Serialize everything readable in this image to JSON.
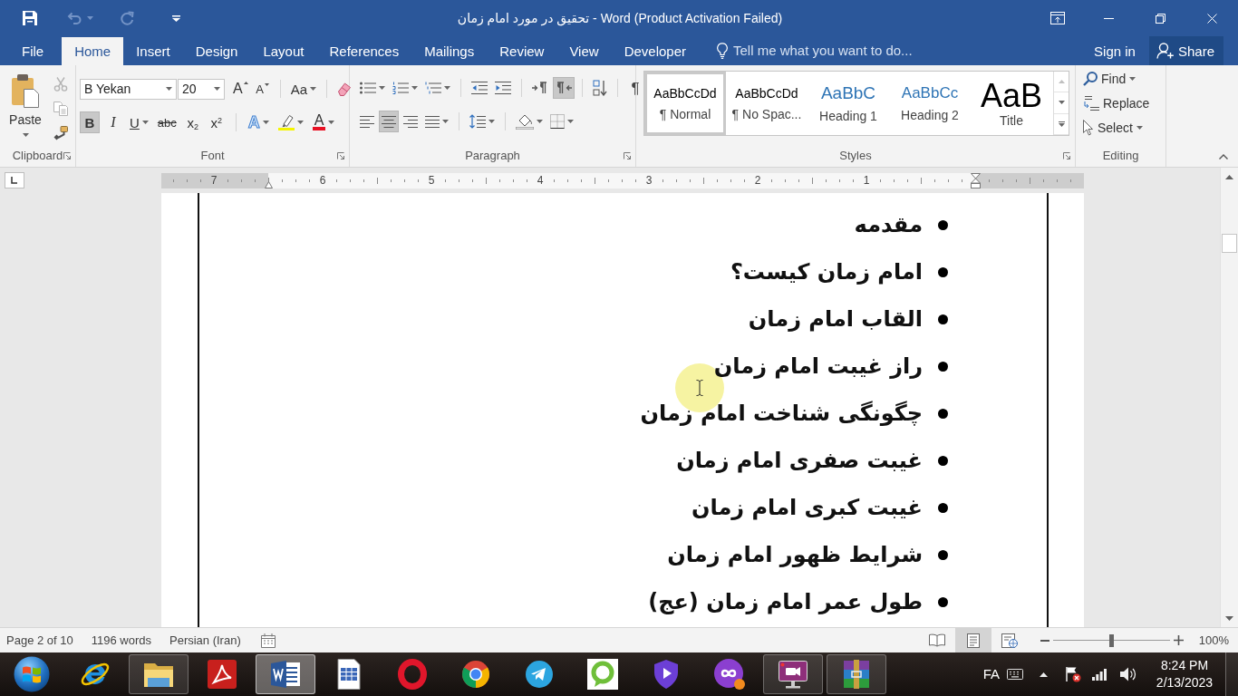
{
  "window": {
    "title": "تحقیق در مورد امام زمان - Word (Product Activation Failed)"
  },
  "quick_access": [
    {
      "disabled": false
    },
    {
      "disabled": true
    },
    {
      "disabled": true
    },
    {
      "disabled": false
    }
  ],
  "tabs": [
    {
      "label": "File",
      "selected": false
    },
    {
      "label": "Home",
      "selected": true
    },
    {
      "label": "Insert",
      "selected": false
    },
    {
      "label": "Design",
      "selected": false
    },
    {
      "label": "Layout",
      "selected": false
    },
    {
      "label": "References",
      "selected": false
    },
    {
      "label": "Mailings",
      "selected": false
    },
    {
      "label": "Review",
      "selected": false
    },
    {
      "label": "View",
      "selected": false
    },
    {
      "label": "Developer",
      "selected": false
    }
  ],
  "tell_me": {
    "placeholder": "Tell me what you want to do..."
  },
  "account": {
    "sign_in": "Sign in",
    "share": "Share"
  },
  "ribbon": {
    "clipboard": {
      "label": "Clipboard",
      "paste": "Paste",
      "tools": [
        {
          "disabled": true
        },
        {
          "disabled": true
        },
        {
          "disabled": false
        }
      ]
    },
    "font": {
      "label": "Font",
      "font_name": "B Yekan",
      "font_size": "20",
      "grow": "A",
      "shrink": "A",
      "change_case": "Aa",
      "formats": [
        {
          "kind": "bold",
          "label": "B",
          "selected": true,
          "dropdown": false
        },
        {
          "kind": "italic",
          "label": "I",
          "selected": false,
          "dropdown": false
        },
        {
          "kind": "underline",
          "label": "U",
          "selected": false,
          "dropdown": true
        },
        {
          "kind": "strike",
          "label": "abc",
          "selected": false,
          "dropdown": false
        },
        {
          "kind": "sub",
          "label": "x$_{2}$",
          "selected": false,
          "dropdown": false
        },
        {
          "kind": "sup",
          "label": "x$^{2}$",
          "selected": false,
          "dropdown": false
        }
      ],
      "text_effects": "A",
      "font_color": "A"
    },
    "paragraph": {
      "label": "Paragraph",
      "direction": [
        {
          "selected": false
        },
        {
          "selected": true
        }
      ],
      "show_marks": "¶",
      "alignment": [
        {
          "selected": false
        },
        {
          "selected": true
        },
        {
          "selected": false
        },
        {
          "selected": false
        }
      ]
    },
    "styles": {
      "label": "Styles",
      "items": [
        {
          "kind": "body",
          "preview": "AaBbCcDd",
          "name": "¶ Normal",
          "selected": true
        },
        {
          "kind": "body",
          "preview": "AaBbCcDd",
          "name": "¶ No Spac...",
          "selected": false
        },
        {
          "kind": "heading1",
          "preview": "AaBbC",
          "name": "Heading 1",
          "selected": false
        },
        {
          "kind": "heading2",
          "preview": "AaBbCc",
          "name": "Heading 2",
          "selected": false
        },
        {
          "kind": "title",
          "preview": "AaB",
          "name": "Title",
          "selected": false
        }
      ]
    },
    "editing": {
      "label": "Editing",
      "items": [
        {
          "label": "Find",
          "dropdown": true
        },
        {
          "label": "Replace",
          "dropdown": false
        },
        {
          "label": "Select",
          "dropdown": true
        }
      ]
    }
  },
  "ruler": {
    "numbers": [
      "7",
      "6",
      "5",
      "4",
      "3",
      "2",
      "1"
    ]
  },
  "document": {
    "bullets": [
      "مقدمه",
      "امام زمان کیست؟",
      "القاب امام زمان",
      "راز غیبت امام زمان",
      "چگونگی شناخت امام زمان",
      "غیبت صفری امام زمان",
      "غیبت کبری امام زمان",
      "شرایط ظهور امام زمان",
      "طول عمر امام زمان (عج)"
    ]
  },
  "status_bar": {
    "page": "Page 2 of 10",
    "words": "1196 words",
    "language": "Persian (Iran)",
    "views": [
      {
        "selected": false
      },
      {
        "selected": true
      },
      {
        "selected": false
      }
    ],
    "zoom": {
      "level": 0.5,
      "reading": "100%"
    }
  },
  "taskbar": {
    "apps": [
      {
        "running": false,
        "selected": false
      },
      {
        "running": true,
        "selected": false
      },
      {
        "running": false,
        "selected": false
      },
      {
        "running": true,
        "selected": true
      },
      {
        "running": false,
        "selected": false
      },
      {
        "running": false,
        "selected": false
      },
      {
        "running": false,
        "selected": false
      },
      {
        "running": false,
        "selected": false
      },
      {
        "running": false,
        "selected": false
      },
      {
        "running": false,
        "selected": false
      },
      {
        "running": false,
        "selected": false
      },
      {
        "running": true,
        "selected": false
      },
      {
        "running": true,
        "selected": false
      }
    ],
    "language": "FA",
    "time": "8:24 PM",
    "date": "2/13/2023"
  }
}
